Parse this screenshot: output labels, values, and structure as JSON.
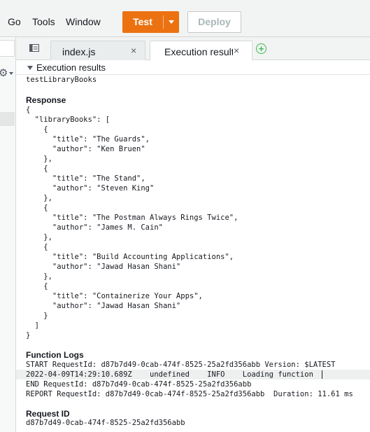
{
  "menu": {
    "go": "Go",
    "tools": "Tools",
    "window": "Window"
  },
  "toolbar": {
    "test_label": "Test",
    "deploy_label": "Deploy"
  },
  "tabs": [
    {
      "label": "index.js",
      "close": "×"
    },
    {
      "label": "Execution results",
      "close": "×"
    }
  ],
  "add_tab": "+",
  "exec": {
    "header": "Execution results",
    "test_name": "testLibraryBooks",
    "response_title": "Response",
    "response_lines": [
      "{",
      "  \"libraryBooks\": [",
      "    {",
      "      \"title\": \"The Guards\",",
      "      \"author\": \"Ken Bruen\"",
      "    },",
      "    {",
      "      \"title\": \"The Stand\",",
      "      \"author\": \"Steven King\"",
      "    },",
      "    {",
      "      \"title\": \"The Postman Always Rings Twice\",",
      "      \"author\": \"James M. Cain\"",
      "    },",
      "    {",
      "      \"title\": \"Build Accounting Applications\",",
      "      \"author\": \"Jawad Hasan Shani\"",
      "    },",
      "    {",
      "      \"title\": \"Containerize Your Apps\",",
      "      \"author\": \"Jawad Hasan Shani\"",
      "    }",
      "  ]",
      "}"
    ],
    "logs_title": "Function Logs",
    "logs": [
      "START RequestId: d87b7d49-0cab-474f-8525-25a2fd356abb Version: $LATEST",
      "2022-04-09T14:29:10.689Z\tundefined\tINFO\tLoading function",
      "END RequestId: d87b7d49-0cab-474f-8525-25a2fd356abb",
      "REPORT RequestId: d87b7d49-0cab-474f-8525-25a2fd356abb  Duration: 11.61 ms"
    ],
    "request_id_title": "Request ID",
    "request_id": "d87b7d49-0cab-474f-8525-25a2fd356abb"
  },
  "icons": {
    "gear": "gear-icon",
    "tabs_list": "tab-list-icon",
    "add_tab": "plus-circle-icon",
    "collapse": "triangle-down-icon"
  },
  "colors": {
    "test_button": "#ec7211",
    "add_tab": "#3cba54"
  }
}
